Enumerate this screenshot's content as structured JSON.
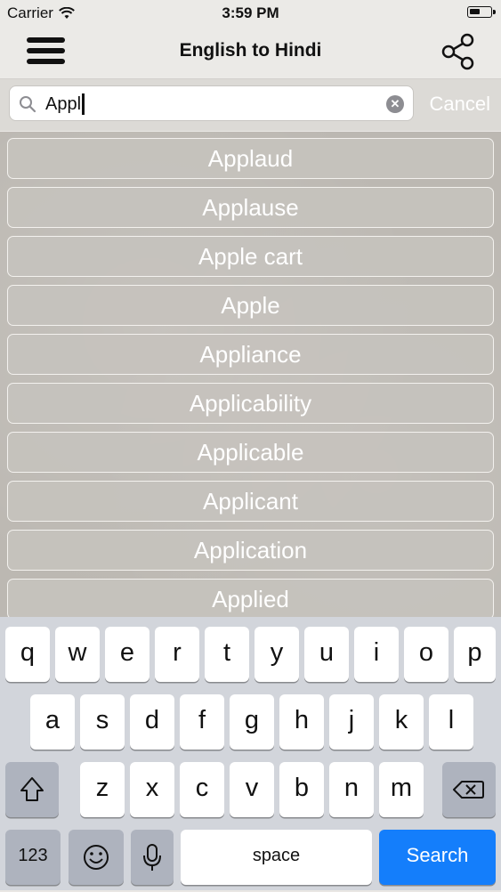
{
  "status_bar": {
    "carrier": "Carrier",
    "time": "3:59 PM"
  },
  "nav": {
    "title": "English to Hindi",
    "menu_icon": "hamburger-menu-icon",
    "share_icon": "share-icon"
  },
  "search": {
    "value": "Appl",
    "cancel_label": "Cancel",
    "clear_icon": "clear-icon",
    "search_icon": "magnifier-icon"
  },
  "results": [
    "Applaud",
    "Applause",
    "Apple cart",
    "Apple",
    "Appliance",
    "Applicability",
    "Applicable",
    "Applicant",
    "Application",
    "Applied"
  ],
  "keyboard": {
    "row1": [
      "q",
      "w",
      "e",
      "r",
      "t",
      "y",
      "u",
      "i",
      "o",
      "p"
    ],
    "row2": [
      "a",
      "s",
      "d",
      "f",
      "g",
      "h",
      "j",
      "k",
      "l"
    ],
    "row3": [
      "z",
      "x",
      "c",
      "v",
      "b",
      "n",
      "m"
    ],
    "numbers_label": "123",
    "space_label": "space",
    "search_label": "Search",
    "icons": [
      "shift-icon",
      "backspace-icon",
      "emoji-icon",
      "microphone-icon"
    ]
  },
  "colors": {
    "accent": "#147efb",
    "nav_bg": "#ebeae7",
    "keyboard_bg": "#d2d5db"
  }
}
